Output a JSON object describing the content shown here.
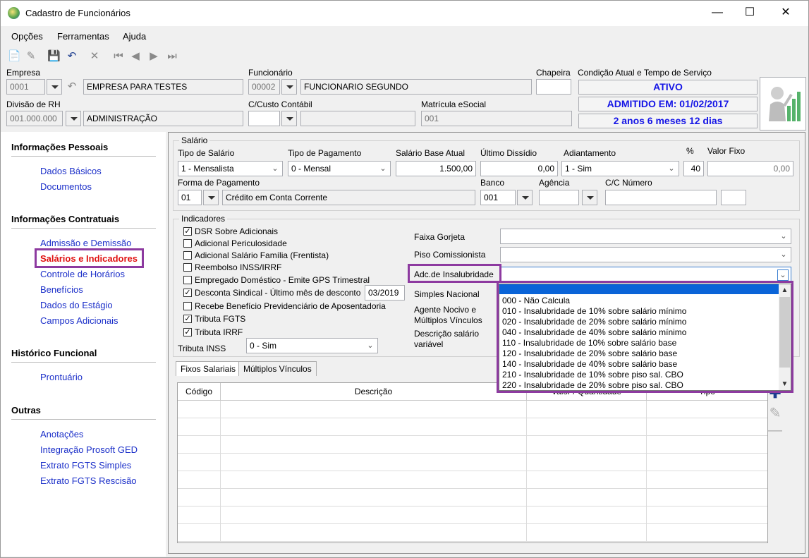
{
  "window": {
    "title": "Cadastro de Funcionários",
    "controls": [
      "minimize-icon",
      "maximize-icon",
      "close-icon"
    ]
  },
  "menu": {
    "items": [
      "Opções",
      "Ferramentas",
      "Ajuda"
    ]
  },
  "toolbar": {
    "icons": [
      "new-icon",
      "edit-icon",
      "save-icon",
      "undo-icon",
      "delete-icon",
      "first-icon",
      "previous-icon",
      "next-icon",
      "last-icon"
    ]
  },
  "header": {
    "empresa_label": "Empresa",
    "empresa_code": "0001",
    "empresa_name": "EMPRESA PARA TESTES",
    "funcionario_label": "Funcionário",
    "funcionario_code": "00002",
    "funcionario_name": "FUNCIONARIO SEGUNDO",
    "chapeira_label": "Chapeira",
    "chapeira_value": "",
    "condicao_label": "Condição Atual e Tempo de Serviço",
    "status": "ATIVO",
    "admitido": "ADMITIDO EM: 01/02/2017",
    "tempo": "2 anos 6 meses 12 dias",
    "divisao_label": "Divisão de RH",
    "divisao_code": "001.000.000",
    "divisao_name": "ADMINISTRAÇÃO",
    "ccusto_label": "C/Custo Contábil",
    "ccusto_code": "",
    "ccusto_name": "",
    "matricula_label": "Matrícula eSocial",
    "matricula_value": "001"
  },
  "sidebar": {
    "sections": [
      {
        "title": "Informações Pessoais",
        "items": [
          "Dados Básicos",
          "Documentos"
        ]
      },
      {
        "title": "Informações Contratuais",
        "items": [
          "Admissão e Demissão",
          "Salários e Indicadores",
          "Controle de Horários",
          "Benefícios",
          "Dados do Estágio",
          "Campos Adicionais"
        ]
      },
      {
        "title": "Histórico Funcional",
        "items": [
          "Prontuário"
        ]
      },
      {
        "title": "Outras",
        "items": [
          "Anotações",
          "Integração Prosoft GED",
          "Extrato FGTS Simples",
          "Extrato FGTS Rescisão"
        ]
      }
    ],
    "active": "Salários e Indicadores"
  },
  "salario": {
    "group_title": "Salário",
    "tipo_salario_label": "Tipo de Salário",
    "tipo_salario_value": "1 - Mensalista",
    "tipo_pagamento_label": "Tipo de Pagamento",
    "tipo_pagamento_value": "0 - Mensal",
    "salario_base_label": "Salário Base Atual",
    "salario_base_value": "1.500,00",
    "ultimo_dissidio_label": "Último Dissídio",
    "ultimo_dissidio_value": "0,00",
    "adiantamento_label": "Adiantamento",
    "adiantamento_value": "1 - Sim",
    "pct_label": "%",
    "pct_value": "40",
    "valor_fixo_label": "Valor Fixo",
    "valor_fixo_value": "0,00",
    "forma_pagamento_label": "Forma de Pagamento",
    "forma_pagamento_code": "01",
    "forma_pagamento_name": "Crédito em Conta Corrente",
    "banco_label": "Banco",
    "banco_value": "001",
    "agencia_label": "Agência",
    "agencia_value": "",
    "cc_label": "C/C Número",
    "cc_value": "",
    "cc_digit": ""
  },
  "indicadores": {
    "group_title": "Indicadores",
    "checkboxes": [
      {
        "label": "DSR Sobre Adicionais",
        "checked": true
      },
      {
        "label": "Adicional Periculosidade",
        "checked": false
      },
      {
        "label": "Adicional Salário Família (Frentista)",
        "checked": false
      },
      {
        "label": "Reembolso INSS/IRRF",
        "checked": false
      },
      {
        "label": "Empregado Doméstico - Emite GPS Trimestral",
        "checked": false
      },
      {
        "label": "Desconta Sindical - Último mês de desconto",
        "checked": true
      },
      {
        "label": "Recebe Benefício Previdenciário de Aposentadoria",
        "checked": false
      },
      {
        "label": "Tributa FGTS",
        "checked": true
      },
      {
        "label": "Tributa IRRF",
        "checked": true
      }
    ],
    "ultimo_mes_value": "03/2019",
    "tributa_inss_label": "Tributa INSS",
    "tributa_inss_value": "0 - Sim",
    "faixa_gorjeta_label": "Faixa Gorjeta",
    "piso_comissionista_label": "Piso Comissionista",
    "adc_insalubridade_label": "Adc.de Insalubridade",
    "simples_nacional_label": "Simples Nacional",
    "agente_nocivo_label_1": "Agente Nocivo e",
    "agente_nocivo_label_2": "Múltiplos Vínculos",
    "descricao_variavel_label_1": "Descrição salário",
    "descricao_variavel_label_2": "variável"
  },
  "insalubridade_options": [
    "",
    "000 - Não Calcula",
    "010 - Insalubridade de 10% sobre salário mínimo",
    "020 - Insalubridade de 20% sobre salário mínimo",
    "040 - Insalubridade de 40% sobre salário mínimo",
    "110 - Insalubridade de 10% sobre salário base",
    "120 - Insalubridade de 20% sobre salário base",
    "140 - Insalubridade de 40% sobre salário base",
    "210 - Insalubridade de 10% sobre piso sal. CBO",
    "220 - Insalubridade de 20% sobre piso sal. CBO"
  ],
  "tabs": [
    "Fixos Salariais",
    "Múltiplos Vínculos"
  ],
  "grid": {
    "columns": [
      "Código",
      "Descrição",
      "Valor / Quantidade",
      "Tipo"
    ]
  },
  "colors": {
    "accent_blue": "#1515e6",
    "highlight_purple": "#8d3aa0",
    "active_nav": "#e01111",
    "link": "#1b2fc9",
    "selection": "#0a64d8"
  }
}
